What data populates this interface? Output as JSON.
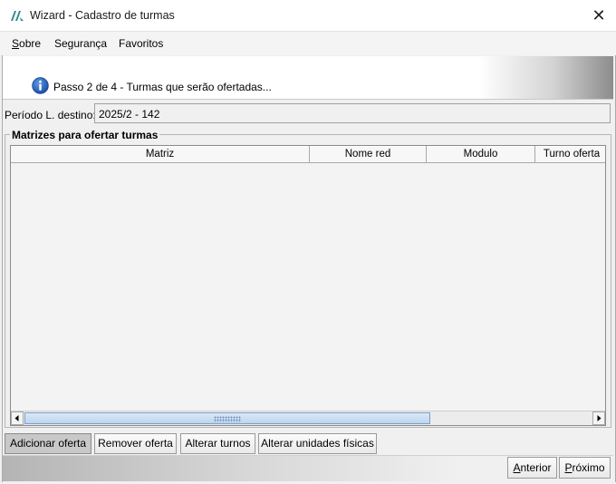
{
  "window": {
    "title": "Wizard - Cadastro de turmas",
    "close_label": "✕"
  },
  "menu": [
    {
      "label_pre": "",
      "mnemonic": "S",
      "label_post": "obre"
    },
    {
      "label": "Segurança"
    },
    {
      "label": "Favoritos"
    }
  ],
  "banner": {
    "step_text": "Passo 2 de 4 - Turmas que serão ofertadas..."
  },
  "periodo": {
    "label": "Período L. destino:",
    "value": "2025/2 - 142"
  },
  "group": {
    "title": "Matrizes para ofertar turmas",
    "columns": [
      "Matriz",
      "Nome red",
      "Modulo",
      "Turno oferta"
    ]
  },
  "actions": {
    "adicionar": "Adicionar oferta",
    "remover": "Remover oferta",
    "alterar_turnos": "Alterar turnos",
    "alterar_unidades": "Alterar unidades físicas"
  },
  "nav": {
    "anterior_mnemonic": "A",
    "anterior_rest": "nterior",
    "proximo_mnemonic": "P",
    "proximo_rest": "róximo"
  },
  "colors": {
    "accent": "#1e5bb8",
    "brand": "#2f8a8a"
  }
}
